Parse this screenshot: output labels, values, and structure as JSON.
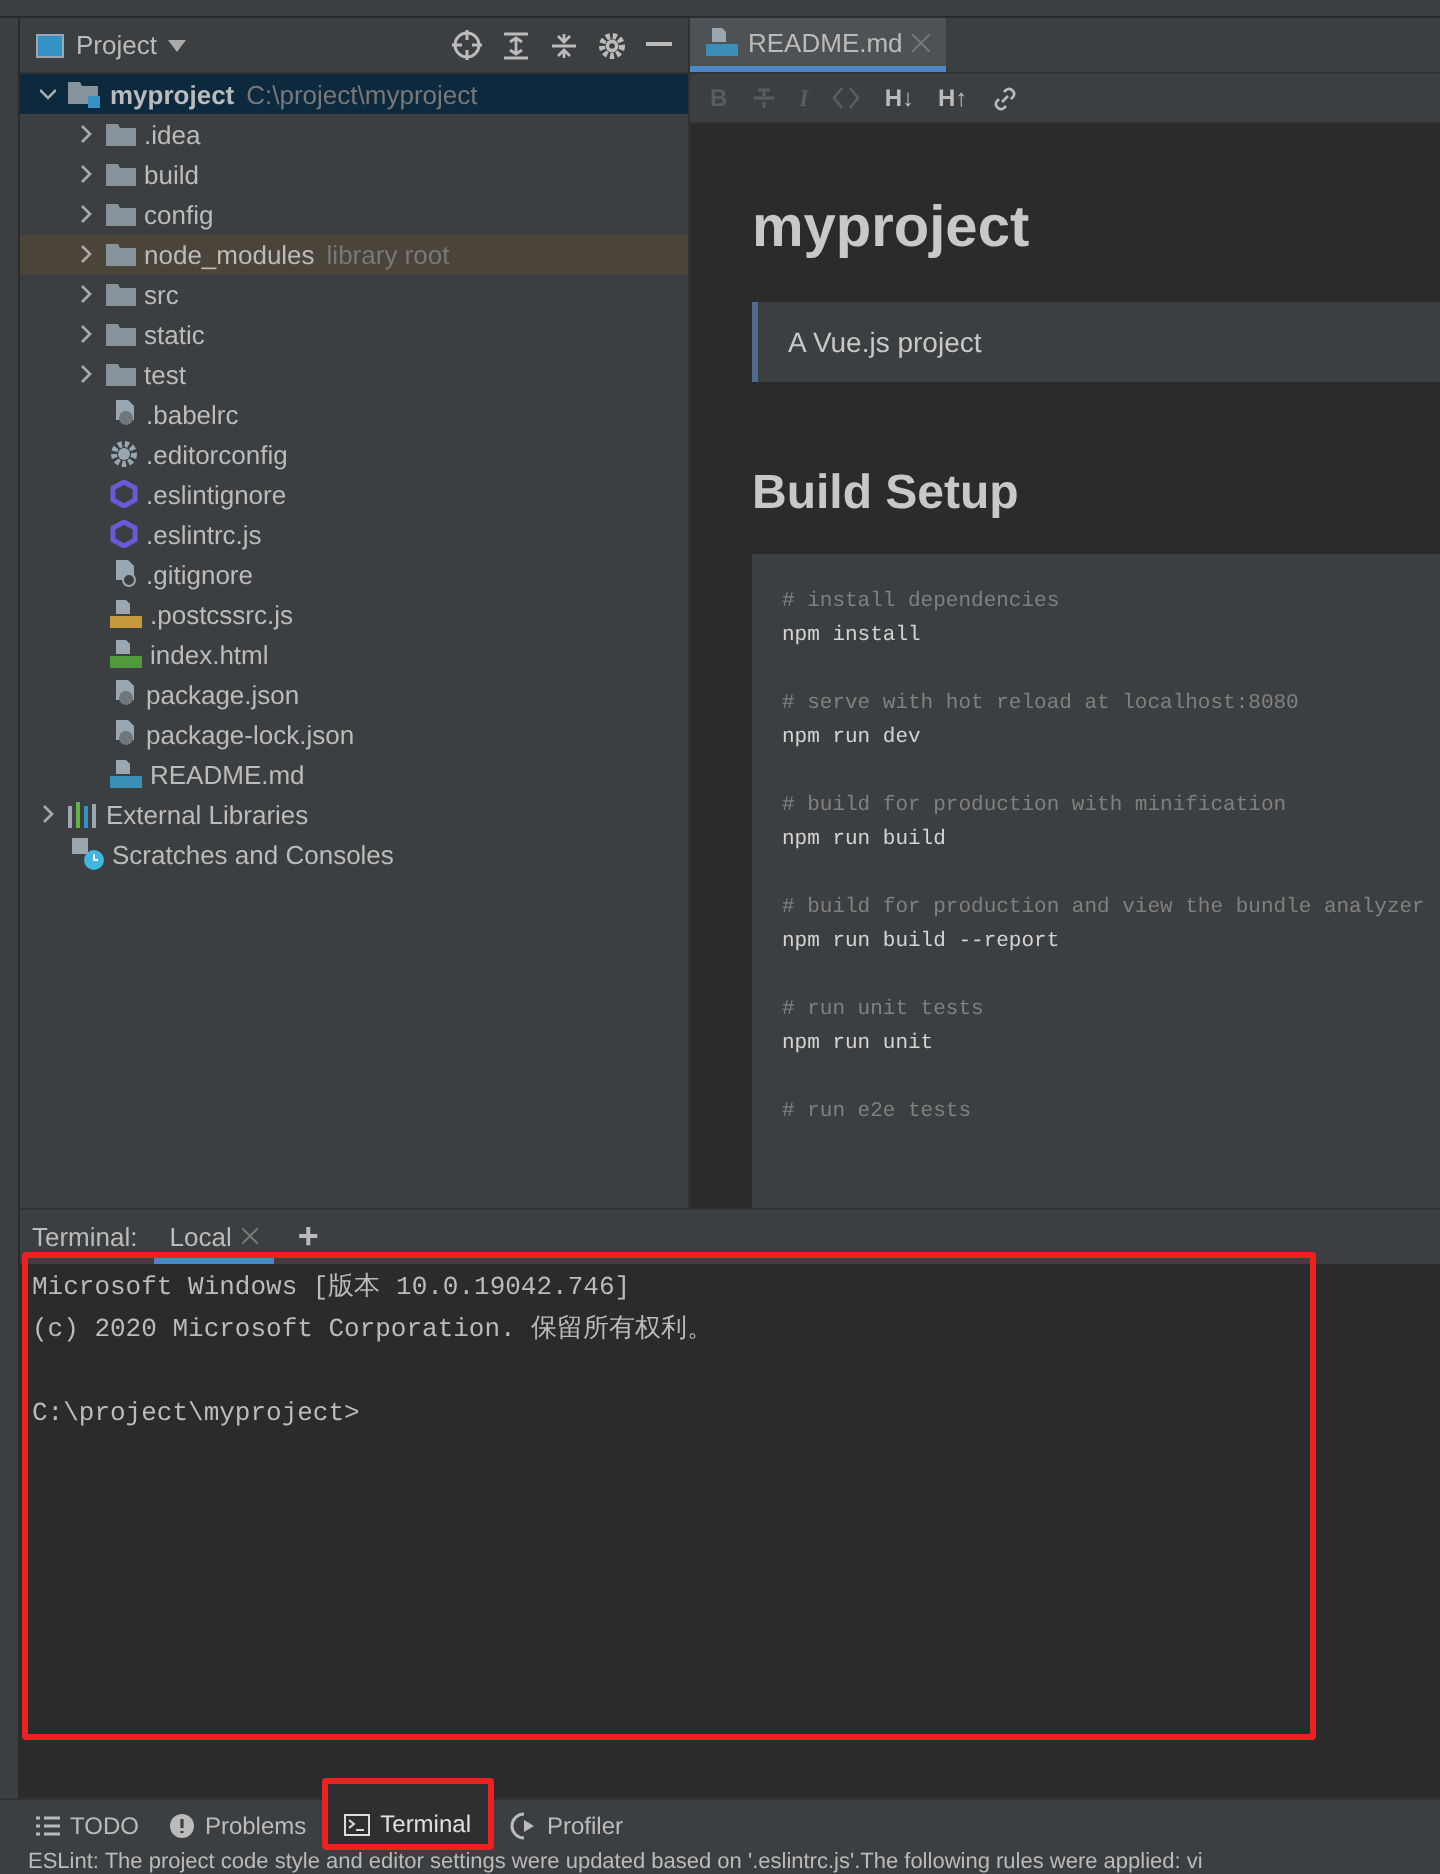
{
  "project_panel": {
    "title": "Project"
  },
  "tree": [
    {
      "name": "myproject",
      "hint": "C:\\project\\myproject",
      "kind": "project",
      "expanded": true,
      "selected": true,
      "children": [
        {
          "name": ".idea",
          "kind": "folder",
          "expanded": false,
          "selected": false
        },
        {
          "name": "build",
          "kind": "folder",
          "expanded": false,
          "selected": false
        },
        {
          "name": "config",
          "kind": "folder",
          "expanded": false,
          "selected": false
        },
        {
          "name": "node_modules",
          "hint": "library root",
          "kind": "library-folder",
          "expanded": false,
          "selected": false
        },
        {
          "name": "src",
          "kind": "folder",
          "expanded": false,
          "selected": false
        },
        {
          "name": "static",
          "kind": "folder",
          "expanded": false,
          "selected": false
        },
        {
          "name": "test",
          "kind": "folder",
          "expanded": false,
          "selected": false
        },
        {
          "name": ".babelrc",
          "kind": "json",
          "selected": false
        },
        {
          "name": ".editorconfig",
          "kind": "config",
          "selected": false
        },
        {
          "name": ".eslintignore",
          "kind": "eslint",
          "selected": false
        },
        {
          "name": ".eslintrc.js",
          "kind": "eslint",
          "selected": false
        },
        {
          "name": ".gitignore",
          "kind": "ignore",
          "selected": false
        },
        {
          "name": ".postcssrc.js",
          "kind": "js",
          "selected": false
        },
        {
          "name": "index.html",
          "kind": "html",
          "selected": false
        },
        {
          "name": "package.json",
          "kind": "json",
          "selected": false
        },
        {
          "name": "package-lock.json",
          "kind": "json",
          "selected": false
        },
        {
          "name": "README.md",
          "kind": "md",
          "selected": false
        }
      ]
    },
    {
      "name": "External Libraries",
      "kind": "libraries",
      "expanded": false,
      "selected": false
    },
    {
      "name": "Scratches and Consoles",
      "kind": "scratches",
      "selected": false
    }
  ],
  "editor_tabs": [
    {
      "label": "README.md",
      "selected": true
    }
  ],
  "md_toolbar": [
    {
      "kind": "bold",
      "label": "B",
      "disabled": true
    },
    {
      "kind": "strike",
      "disabled": true
    },
    {
      "kind": "italic",
      "label": "I",
      "disabled": true
    },
    {
      "kind": "code",
      "disabled": true
    },
    {
      "kind": "heading",
      "label": "H↓",
      "disabled": false
    },
    {
      "kind": "heading",
      "label": "H↑",
      "disabled": false
    },
    {
      "kind": "link",
      "disabled": false
    }
  ],
  "preview": {
    "title": "myproject",
    "quote": "A Vue.js project",
    "heading": "Build Setup",
    "code": [
      {
        "comment": "# install dependencies",
        "command": "npm install"
      },
      {
        "comment": "# serve with hot reload at localhost:8080",
        "command": "npm run dev"
      },
      {
        "comment": "# build for production with minification",
        "command": "npm run build"
      },
      {
        "comment": "# build for production and view the bundle analyzer",
        "command": "npm run build --report"
      },
      {
        "comment": "# run unit tests",
        "command": "npm run unit"
      },
      {
        "comment": "# run e2e tests"
      }
    ]
  },
  "terminal": {
    "label": "Terminal:",
    "tabs": [
      {
        "label": "Local",
        "selected": true
      }
    ],
    "add": "+",
    "highlighted": true,
    "lines": [
      "Microsoft Windows [版本 10.0.19042.746]",
      "(c) 2020 Microsoft Corporation. 保留所有权利。"
    ],
    "prompt": "C:\\project\\myproject>"
  },
  "tool_windows": [
    {
      "kind": "todo",
      "label": "TODO",
      "selected": false,
      "highlighted": false
    },
    {
      "kind": "problems",
      "label": "Problems",
      "selected": false,
      "highlighted": false
    },
    {
      "kind": "terminal",
      "label": "Terminal",
      "selected": true,
      "highlighted": true
    },
    {
      "kind": "profiler",
      "label": "Profiler",
      "selected": false,
      "highlighted": false
    }
  ],
  "status_bar": "ESLint: The project code style and editor settings were updated based on '.eslintrc.js'.The following rules were applied: vi"
}
